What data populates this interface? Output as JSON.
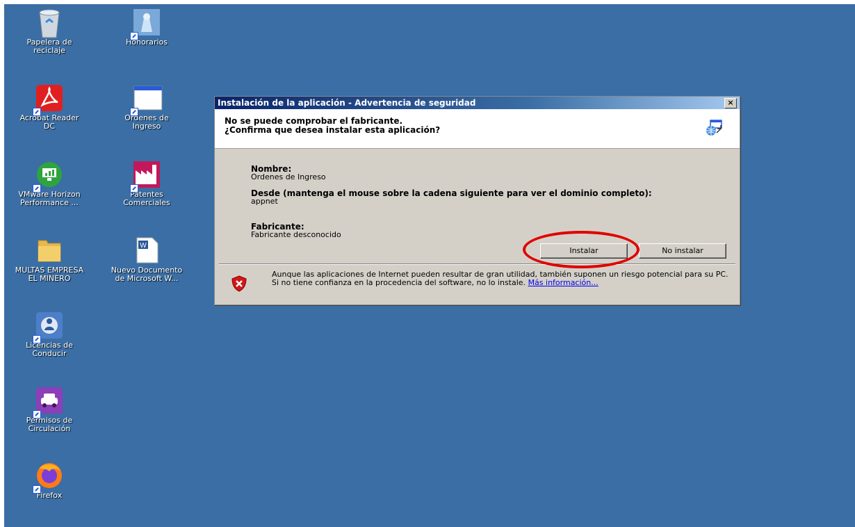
{
  "desktop": {
    "icons": [
      {
        "name": "Papelera de\nreciclaje"
      },
      {
        "name": "Honorarios"
      },
      {
        "name": "Acrobat Reader\nDC"
      },
      {
        "name": "Ordenes de\nIngreso"
      },
      {
        "name": "VMware Horizon\nPerformance ..."
      },
      {
        "name": "Patentes\nComerciales"
      },
      {
        "name": "MULTAS EMPRESA\nEL MINERO"
      },
      {
        "name": "Nuevo Documento\nde Microsoft W..."
      },
      {
        "name": "Licencias de\nConducir"
      },
      {
        "name": "Permisos de\nCirculación"
      },
      {
        "name": "Firefox"
      }
    ]
  },
  "dialog": {
    "title": "Instalación de la aplicación - Advertencia de seguridad",
    "close": "×",
    "header_line1": "No se puede comprobar el fabricante.",
    "header_line2": "¿Confirma que desea instalar esta aplicación?",
    "name_label": "Nombre:",
    "name_value": "Ordenes de Ingreso",
    "from_label": "Desde (mantenga el mouse sobre la cadena siguiente para ver el dominio completo):",
    "from_value": "appnet",
    "publisher_label": "Fabricante:",
    "publisher_value": "Fabricante desconocido",
    "install_button": "Instalar",
    "dont_install_button": "No instalar",
    "warning_text": "Aunque las aplicaciones de Internet pueden resultar de gran utilidad, también suponen un riesgo potencial para su PC. Si no tiene confianza en la procedencia del software, no lo instale.",
    "more_info_link": "Más información..."
  },
  "colors": {
    "desktop": "#3a6ea5",
    "annotation": "#e00000",
    "titlebar": "#0a246a"
  }
}
